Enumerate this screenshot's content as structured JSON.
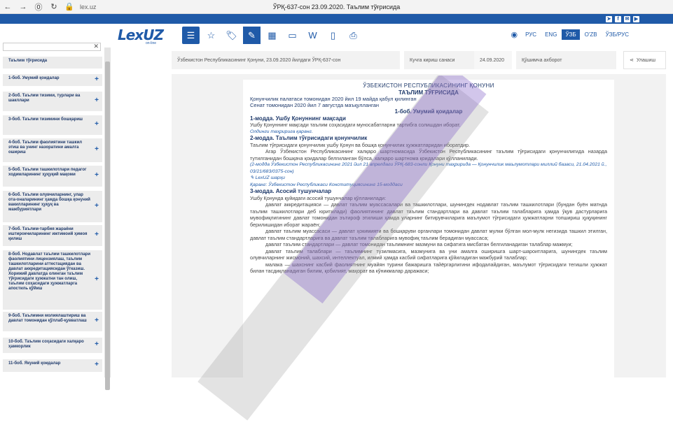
{
  "browser": {
    "url": "lex.uz",
    "title": "ЎРҚ-637-сон 23.09.2020. Таълим тўғрисида"
  },
  "header": {
    "logo_text": "LexUZ",
    "logo_sub": "on-line",
    "languages": [
      "РУС",
      "ENG",
      "ЎЗБ",
      "O'ZB",
      "ЎЗБ/РУС"
    ],
    "active_language": "ЎЗБ"
  },
  "sidebar": {
    "items": [
      {
        "label": "Таълим тўғрисида"
      },
      {
        "label": "1-боб. Умумий қоидалар"
      },
      {
        "label": "2-боб. Таълим тизими, турлари ва шакллари"
      },
      {
        "label": "3-боб. Таълим тизимини бошқариш"
      },
      {
        "label": "4-боб. Таълим фаолиятини ташкил этиш ва унинг назоратини амалга ошириш"
      },
      {
        "label": "5-боб. Таълим ташкилотлари педагог ходимларининг ҳуқуқий мақоми"
      },
      {
        "label": "6-боб. Таълим олувчиларнинг, улар ота-оналарининг ҳамда бошқа қонуний вакилларининг ҳуқуқ ва мажбуриятлари"
      },
      {
        "label": "7-боб. Таълим-тарбия жараёни иштирокчиларининг ижтимоий ҳимоя қилиш"
      },
      {
        "label": "8-боб. Нодавлат таълим ташкилотлари фаолиятини лицензиялаш, таълим ташкилотларини аттестациядан ва давлат аккредитациясидан ўтказиш. Хорижий давлатда олинган таълим тўғрисидаги ҳужжатни тан олиш, таълим соҳасидаги ҳужжатларга апостиль қўйиш"
      },
      {
        "label": "9-боб. Таълимни молиялаштириш ва давлат томонидан қўллаб-қувватлаш"
      },
      {
        "label": "10-боб. Таълим соҳасидаги халқаро ҳамкорлик"
      },
      {
        "label": "11-боб. Якуний қоидалар"
      }
    ]
  },
  "metabar": {
    "doc_name": "Ўзбекистон Республикасининг Қонуни, 23.09.2020 йилдаги ЎРҚ-637-сон",
    "effective_label": "Кучга кириш санаси",
    "effective_date": "24.09.2020",
    "status": "Қўшимча ахборот",
    "share": "Улашиш"
  },
  "document": {
    "heading": "ЎЗБЕКИСТОН РЕСПУБЛИКАСИНИНГ ҚОНУНИ",
    "title": "ТАЪЛИМ ТЎҒРИСИДА",
    "passed1": "Қонунчилик палатаси томонидан 2020 йил 19 майда қабул қилинган",
    "passed2": "Сенат томонидан 2020 йил 7 августда маъқулланган",
    "chapter1": "1-боб. Умумий қоидалар",
    "art1_title": "1-модда. Ушбу Қонуннинг мақсади",
    "art1_text": "Ушбу Қонуннинг мақсади таълим соҳасидаги муносабатларни тартибга солишдан иборат.",
    "old_version": "Олдинги таҳририга қаранг.",
    "art2_title": "2-модда. Таълим тўғрисидаги қонунчилик",
    "art2_text1": "Таълим тўғрисидаги қонунчилик ушбу Қонун ва бошқа қонунчилик ҳужжатларидан иборатдир.",
    "art2_text2": "Агар Ўзбекистон Республикасининг халқаро шартномасида Ўзбекистон Республикасининг таълим тўғрисидаги қонунчилигида назарда тутилганидан бошқача қоидалар белгиланган бўлса, халқаро шартнома қоидалари қўлланилади.",
    "art2_note": "(2-модда Ўзбекистон Республикасининг 2021 йил 21 апрелдаги ЎРҚ-683-сонли Қонуни таҳририда — Қонунчилик маълумотлари миллий базаси, 21.04.2021 й., 03/21/683/0375-сон)",
    "lex_note": "LexUZ шарҳи",
    "lex_ref": "Қаранг: Ўзбекистон Республикаси Конституциясининг 15-моддаси",
    "art3_title": "3-модда. Асосий тушунчалар",
    "art3_intro": "Ушбу Қонунда қуйидаги асосий тушунчалар қўлланилади:",
    "art3_p1": "давлат аккредитацияси — давлат таълим муассасалари ва ташкилотлари, шунингдек нодавлат таълим ташкилотлари (бундан буён матнда таълим ташкилотлари деб юритилади) фаолиятининг давлат таълим стандартлари ва давлат таълим талабларига ҳамда ўқув дастурларига мувофиқлигининг давлат томонидан эътироф этилиши ҳамда уларнинг битирувчиларига маълумот тўғрисидаги ҳужжатларни топшириш ҳуқуқининг берилишидан иборат жараён;",
    "art3_p2": "давлат таълим муассасаси — давлат ҳокимияти ва бошқаруви органлари томонидан давлат мулки бўлган мол-мулк негизида ташкил этилган, давлат таълим стандартларига ва давлат таълим талабларига мувофиқ таълим берадиган муассаса;",
    "art3_p3": "давлат таълим стандартлари — давлат томонидан таълимнинг мазмуни ва сифатига мисбатан белгиланадиган талаблар мажмуи;",
    "art3_p4": "давлат таълим талаблари — таълимнинг тузилмасига, мазмунига ва уни амалга оширишга шарт-шароитларига, шунингдек таълим олувчиларнинг жисмоний, шахсий, интеллектуал, илмий ҳамда касбий сифатларига қўйиладиган мажбурий талаблар;",
    "art3_p5": "малака — шахснинг касбий фаолиятнинг муайян турини бажаришга тайёргарлигини ифодалайдиган, маълумот тўғрисидаги тегишли ҳужжат билан тасдиқланадиган билим, қобилият, маҳорат ва кўникмалар даражаси;"
  }
}
